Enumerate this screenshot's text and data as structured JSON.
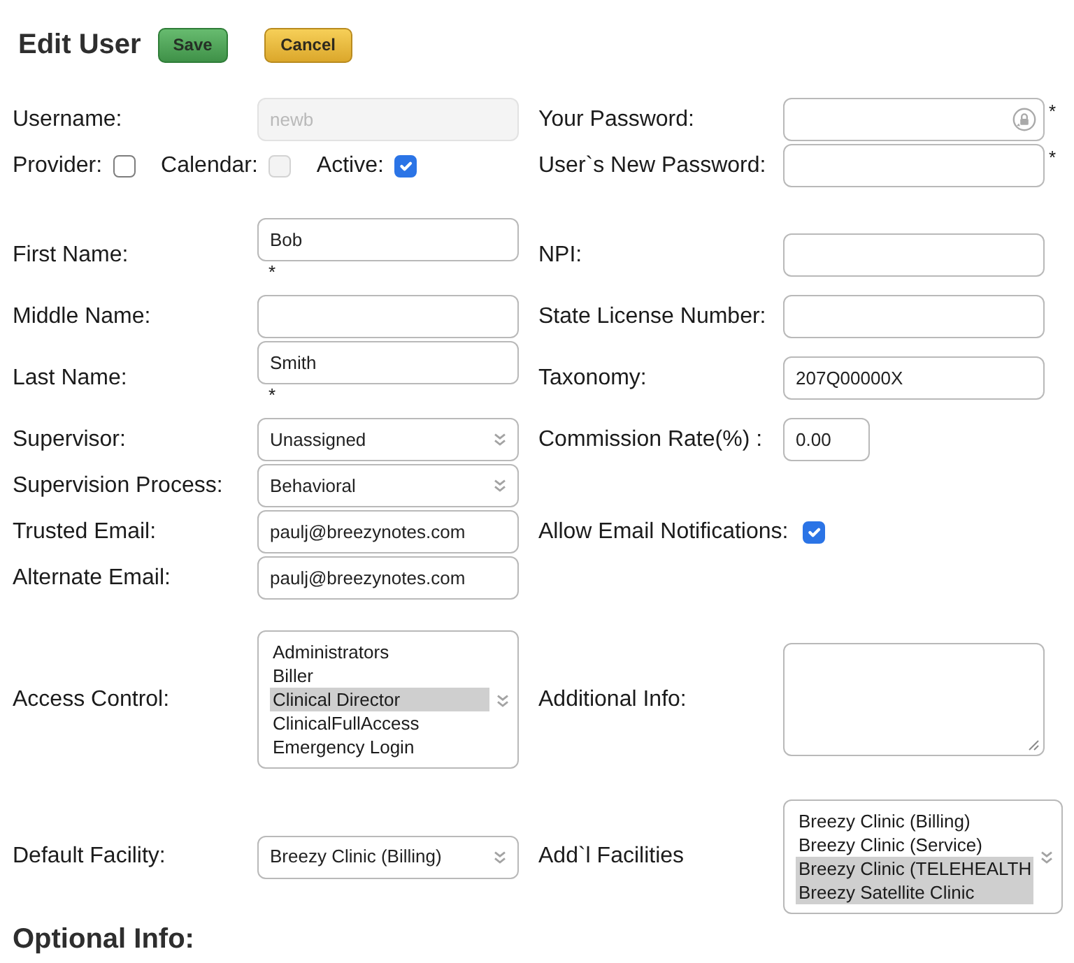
{
  "header": {
    "title": "Edit User",
    "buttons": [
      {
        "kind": "save",
        "label": "Save"
      },
      {
        "kind": "cancel",
        "label": "Cancel"
      }
    ]
  },
  "sections": [
    [
      {
        "left": {
          "kind": "text",
          "label": "Username:",
          "value": "newb",
          "disabled": true
        },
        "right": {
          "kind": "password",
          "label": "Your Password:",
          "disabled": false,
          "autofill": true,
          "required_mark": "*"
        }
      },
      {
        "left": {
          "kind": "checkboxes",
          "items": [
            {
              "label": "Provider:",
              "checked": false,
              "disabled": false
            },
            {
              "label": "Calendar:",
              "checked": false,
              "disabled": true
            },
            {
              "label": "Active:",
              "checked": true,
              "disabled": false
            }
          ]
        },
        "right": {
          "kind": "password",
          "label": "User`s New Password:",
          "disabled": false,
          "autofill": false,
          "required_mark": "*"
        }
      }
    ],
    [
      {
        "left": {
          "kind": "text",
          "label": "First Name:",
          "value": "Bob",
          "disabled": false,
          "required_mark": "*"
        },
        "right": {
          "kind": "text",
          "label": "NPI:",
          "disabled": false
        }
      },
      {
        "left": {
          "kind": "text",
          "label": "Middle Name:",
          "disabled": false
        },
        "right": {
          "kind": "text",
          "label": "State License Number:",
          "disabled": false
        }
      },
      {
        "left": {
          "kind": "text",
          "label": "Last Name:",
          "value": "Smith",
          "disabled": false,
          "required_mark": "*"
        },
        "right": {
          "kind": "text",
          "label": "Taxonomy:",
          "value": "207Q00000X",
          "disabled": false
        }
      },
      {
        "left": {
          "kind": "select",
          "label": "Supervisor:",
          "value": "Unassigned"
        },
        "right": {
          "kind": "number",
          "label": "Commission Rate(%) :",
          "value": "0.00",
          "disabled": false
        }
      },
      {
        "left": {
          "kind": "select",
          "label": "Supervision Process:",
          "value": "Behavioral"
        }
      },
      {
        "left": {
          "kind": "text",
          "label": "Trusted Email:",
          "value": "paulj@breezynotes.com",
          "disabled": false
        },
        "right": {
          "kind": "checkbox",
          "label": "Allow Email Notifications:",
          "checked": true
        }
      },
      {
        "left": {
          "kind": "text",
          "label": "Alternate Email:",
          "value": "paulj@breezynotes.com",
          "disabled": false
        }
      }
    ],
    [
      {
        "left": {
          "kind": "listbox",
          "label": "Access Control:",
          "options": [
            {
              "label": "Administrators",
              "selected": false
            },
            {
              "label": "Biller",
              "selected": false
            },
            {
              "label": "Clinical Director",
              "selected": true
            },
            {
              "label": "ClinicalFullAccess",
              "selected": false
            },
            {
              "label": "Emergency Login",
              "selected": false
            }
          ]
        },
        "right": {
          "kind": "textarea",
          "label": "Additional Info:"
        }
      }
    ],
    [
      {
        "left": {
          "kind": "select",
          "label": "Default Facility:",
          "value": "Breezy Clinic (Billing)"
        },
        "right": {
          "kind": "listbox",
          "label": "Add`l Facilities",
          "options": [
            {
              "label": "Breezy Clinic (Billing)",
              "selected": false
            },
            {
              "label": "Breezy Clinic (Service)",
              "selected": false
            },
            {
              "label": "Breezy Clinic (TELEHEALTH",
              "selected": true
            },
            {
              "label": "Breezy Satellite Clinic",
              "selected": true
            }
          ]
        }
      }
    ]
  ],
  "footer_heading": "Optional Info:"
}
